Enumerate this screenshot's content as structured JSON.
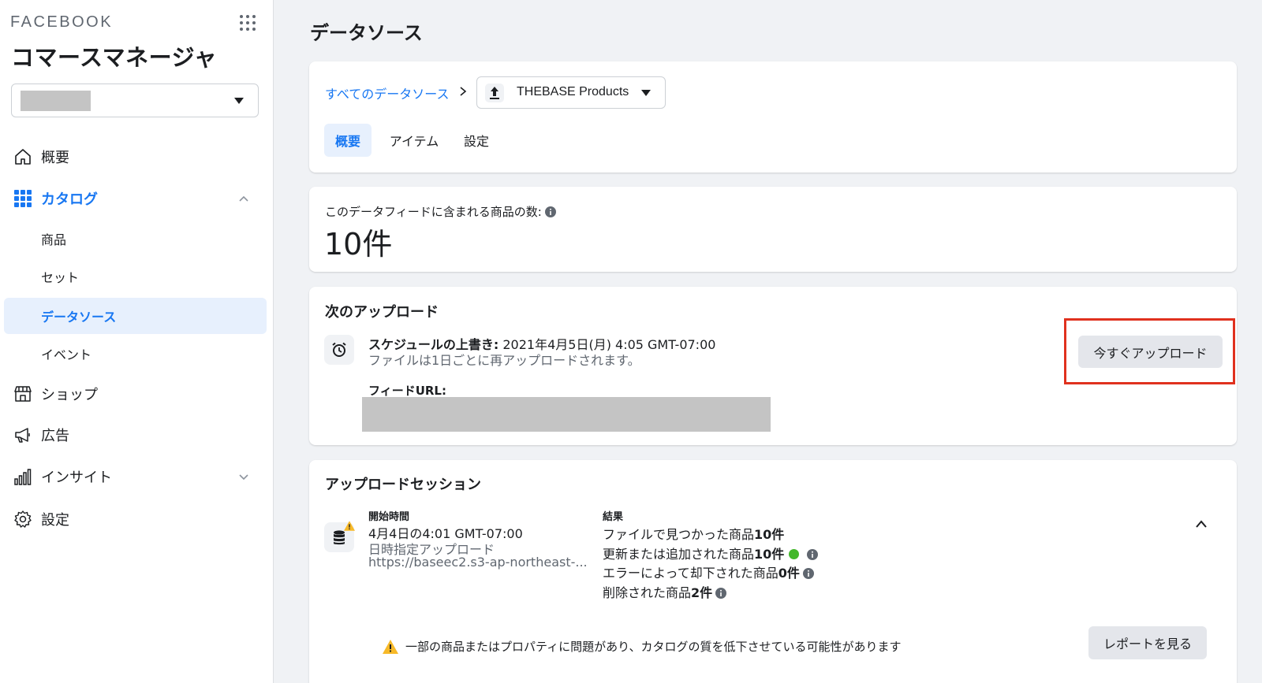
{
  "sidebar": {
    "brand": "FACEBOOK",
    "app_title": "コマースマネージャ",
    "nav": {
      "overview": "概要",
      "catalog": "カタログ",
      "products": "商品",
      "sets": "セット",
      "data_sources": "データソース",
      "events": "イベント",
      "shop": "ショップ",
      "ads": "広告",
      "insights": "インサイト",
      "settings": "設定"
    }
  },
  "main": {
    "page_title": "データソース",
    "breadcrumb": {
      "all_sources": "すべてのデータソース",
      "selected_source": "THEBASE Products"
    },
    "tabs": [
      "概要",
      "アイテム",
      "設定"
    ],
    "feed_count": {
      "label": "このデータフィードに含まれる商品の数:",
      "value": "10件"
    },
    "next_upload": {
      "title": "次のアップロード",
      "schedule_label": "スケジュールの上書き:",
      "schedule_value": " 2021年4月5日(月) 4:05 GMT-07:00",
      "schedule_note": "ファイルは1日ごとに再アップロードされます。",
      "feed_url_label": "フィードURL:",
      "upload_now": "今すぐアップロード"
    },
    "upload_sessions": {
      "title": "アップロードセッション",
      "start_time_head": "開始時間",
      "start_time": "4月4日の4:01 GMT-07:00",
      "upload_type": "日時指定アップロード",
      "url": "https://baseec2.s3-ap-northeast-...",
      "result_head": "結果",
      "found_text": "ファイルで見つかった商品",
      "found_count": "10件",
      "updated_text": "更新または追加された商品",
      "updated_count": "10件",
      "rejected_text": "エラーによって却下された商品",
      "rejected_count": "0件",
      "deleted_text": "削除された商品",
      "deleted_count": "2件",
      "warning": "一部の商品またはプロパティに問題があり、カタログの質を低下させている可能性があります",
      "view_report": "レポートを見る"
    }
  },
  "colors": {
    "accent": "#1877f2",
    "highlight": "#e0311e",
    "success": "#42b72a",
    "warning": "#f7b928"
  }
}
